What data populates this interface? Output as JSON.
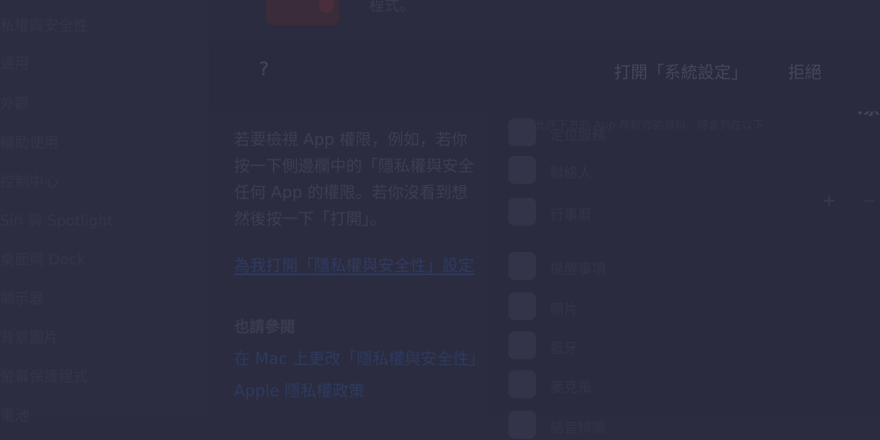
{
  "sidebar": {
    "items": [
      {
        "label": "私權與安全性"
      },
      {
        "label": "通用"
      },
      {
        "label": "外觀"
      },
      {
        "label": "輔助使用"
      },
      {
        "label": "控制中心"
      },
      {
        "label": "Siri 與 Spotlight"
      },
      {
        "label": "桌面與 Dock"
      },
      {
        "label": "顯示器"
      },
      {
        "label": "背景圖片"
      },
      {
        "label": "螢幕保護程式"
      },
      {
        "label": "電池"
      }
    ]
  },
  "article": {
    "top_text": "程式。",
    "paragraph": "若要檢視 App 權限，例如，若你\n按一下側邊欄中的「隱私權與安全\n任何 App 的權限。若你沒看到想\n然後按一下「打開」。",
    "main_link": "為我打開「隱私權與安全性」設定",
    "see_also_heading": "也請參閱",
    "see_also_links": [
      {
        "label": "在 Mac 上更改「隱私權與安全性」"
      },
      {
        "label": "Apple 隱私權政策"
      }
    ]
  },
  "dialog": {
    "help_label": "?",
    "open_settings_label": "打開「系統設定」",
    "deny_label": "拒絕"
  },
  "settings": {
    "title": ".系",
    "description": "允許下方的 App 存取你的資料。將會列在以下",
    "rows": [
      {
        "label": "定位服務"
      },
      {
        "label": "聯絡人"
      },
      {
        "label": "行事曆"
      },
      {
        "label": "提醒事項"
      },
      {
        "label": "照片"
      },
      {
        "label": "藍牙"
      },
      {
        "label": "麥克風"
      },
      {
        "label": "語音辨識"
      }
    ],
    "add_label": "+",
    "remove_label": "−"
  }
}
